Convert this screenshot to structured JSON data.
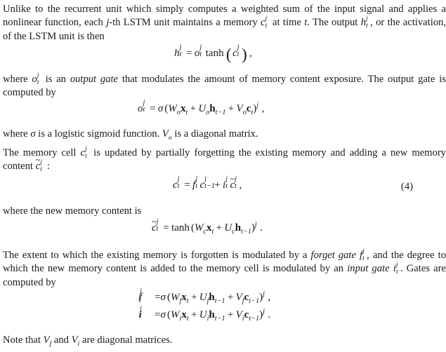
{
  "document": {
    "type": "academic-paper-excerpt",
    "topic": "LSTM unit equations",
    "background_color": "#ffffff",
    "text_color": "#1a1a1a"
  },
  "paragraphs": {
    "p1": {
      "seg1": "Unlike to the recurrent unit which simply computes a weighted sum of the input signal and applies a nonlinear function, each ",
      "math_j": "j",
      "seg2": "-th LSTM unit maintains a memory ",
      "math_c": "c",
      "math_c_sup": "j",
      "math_c_sub": "t",
      "seg3": " at time ",
      "math_t": "t",
      "seg4": ". The output ",
      "math_h": "h",
      "math_h_sup": "j",
      "math_h_sub": "t",
      "seg5": ", or the activation, of the LSTM unit is then"
    },
    "p2": {
      "seg1": "where ",
      "math_o": "o",
      "math_o_sup": "j",
      "math_o_sub": "t",
      "seg2": " is an ",
      "emph": "output gate",
      "seg3": " that modulates the amount of memory content exposure. The output gate is computed by"
    },
    "p3": {
      "seg1": "where ",
      "math_sigma": "σ",
      "seg2": " is a logistic sigmoid function. ",
      "math_V": "V",
      "math_V_sub": "o",
      "seg3": " is a diagonal matrix."
    },
    "p4": {
      "seg1": "The memory cell ",
      "math_c": "c",
      "math_c_sup": "j",
      "math_c_sub": "t",
      "seg2": " is updated by partially forgetting the existing memory and adding a new memory content ",
      "math_ctilde": "c",
      "math_ctilde_accent": "~",
      "math_ctilde_sup": "j",
      "math_ctilde_sub": "t",
      "seg3": " :"
    },
    "p5": {
      "text": "where the new memory content is"
    },
    "p6": {
      "seg1": "The extent to which the existing memory is forgotten is modulated by a ",
      "emph1": "forget gate",
      "seg2": " ",
      "math_f": "f",
      "math_f_sup": "j",
      "math_f_sub": "t",
      "seg3": ", and the degree to which the new memory content is added to the memory cell is modulated by an ",
      "emph2": "input gate",
      "seg4": " ",
      "math_i": "i",
      "math_i_sup": "j",
      "math_i_sub": "t",
      "seg5": ". Gates are computed by"
    },
    "p7": {
      "seg1": "Note that ",
      "math_Vf": "V",
      "math_Vf_sub": "f",
      "seg2": " and ",
      "math_Vi": "V",
      "math_Vi_sub": "i",
      "seg3": " are diagonal matrices."
    }
  },
  "equations": {
    "eq_h": {
      "lhs_base": "h",
      "lhs_sup": "j",
      "lhs_sub": "t",
      "eq": "=",
      "o_base": "o",
      "o_sup": "j",
      "o_sub": "t",
      "func": "tanh",
      "paren_open": "(",
      "arg_base": "c",
      "arg_sup": "j",
      "arg_sub": "t",
      "paren_close": ")",
      "trailing": ","
    },
    "eq_o": {
      "lhs_base": "o",
      "lhs_sup": "j",
      "lhs_sub": "t",
      "eq": "=",
      "sigma": "σ",
      "paren_open": "(",
      "W": "W",
      "W_sub": "o",
      "x": "x",
      "x_sub": "t",
      "plus1": "+",
      "U": "U",
      "U_sub": "o",
      "h": "h",
      "h_sub": "t−1",
      "plus2": "+",
      "V": "V",
      "V_sub": "o",
      "c": "c",
      "c_sub": "t",
      "paren_close": ")",
      "sup_j": "j",
      "trailing": ","
    },
    "eq_c": {
      "lhs_base": "c",
      "lhs_sup": "j",
      "lhs_sub": "t",
      "eq": "=",
      "f_base": "f",
      "f_sup": "j",
      "f_sub": "t",
      "c_base": "c",
      "c_sup": "j",
      "c_sub": "t−1",
      "plus": "+",
      "i_base": "i",
      "i_sup": "j",
      "i_sub": "t",
      "ct_base": "c",
      "ct_accent": "~",
      "ct_sup": "j",
      "ct_sub": "t",
      "trailing": ",",
      "number": "(4)"
    },
    "eq_ctilde": {
      "lhs_base": "c",
      "lhs_accent": "~",
      "lhs_sup": "j",
      "lhs_sub": "t",
      "eq": "=",
      "func": "tanh",
      "paren_open": "(",
      "W": "W",
      "W_sub": "c",
      "x": "x",
      "x_sub": "t",
      "plus": "+",
      "U": "U",
      "U_sub": "c",
      "h": "h",
      "h_sub": "t−1",
      "paren_close": ")",
      "sup_j": "j",
      "trailing": "."
    },
    "eq_f": {
      "lhs_base": "f",
      "lhs_sup": "j",
      "lhs_sub": "t",
      "eq": "=",
      "sigma": "σ",
      "paren_open": "(",
      "W": "W",
      "W_sub": "f",
      "x": "x",
      "x_sub": "t",
      "plus1": "+",
      "U": "U",
      "U_sub": "f",
      "h": "h",
      "h_sub": "t−1",
      "plus2": "+",
      "V": "V",
      "V_sub": "f",
      "c": "c",
      "c_sub": "t−1",
      "paren_close": ")",
      "sup_j": "j",
      "trailing": ","
    },
    "eq_i": {
      "lhs_base": "i",
      "lhs_sup": "j",
      "lhs_sub": "t",
      "eq": "=",
      "sigma": "σ",
      "paren_open": "(",
      "W": "W",
      "W_sub": "i",
      "x": "x",
      "x_sub": "t",
      "plus1": "+",
      "U": "U",
      "U_sub": "i",
      "h": "h",
      "h_sub": "t−1",
      "plus2": "+",
      "V": "V",
      "V_sub": "i",
      "c": "c",
      "c_sub": "t−1",
      "paren_close": ")",
      "sup_j": "j",
      "trailing": "."
    }
  }
}
